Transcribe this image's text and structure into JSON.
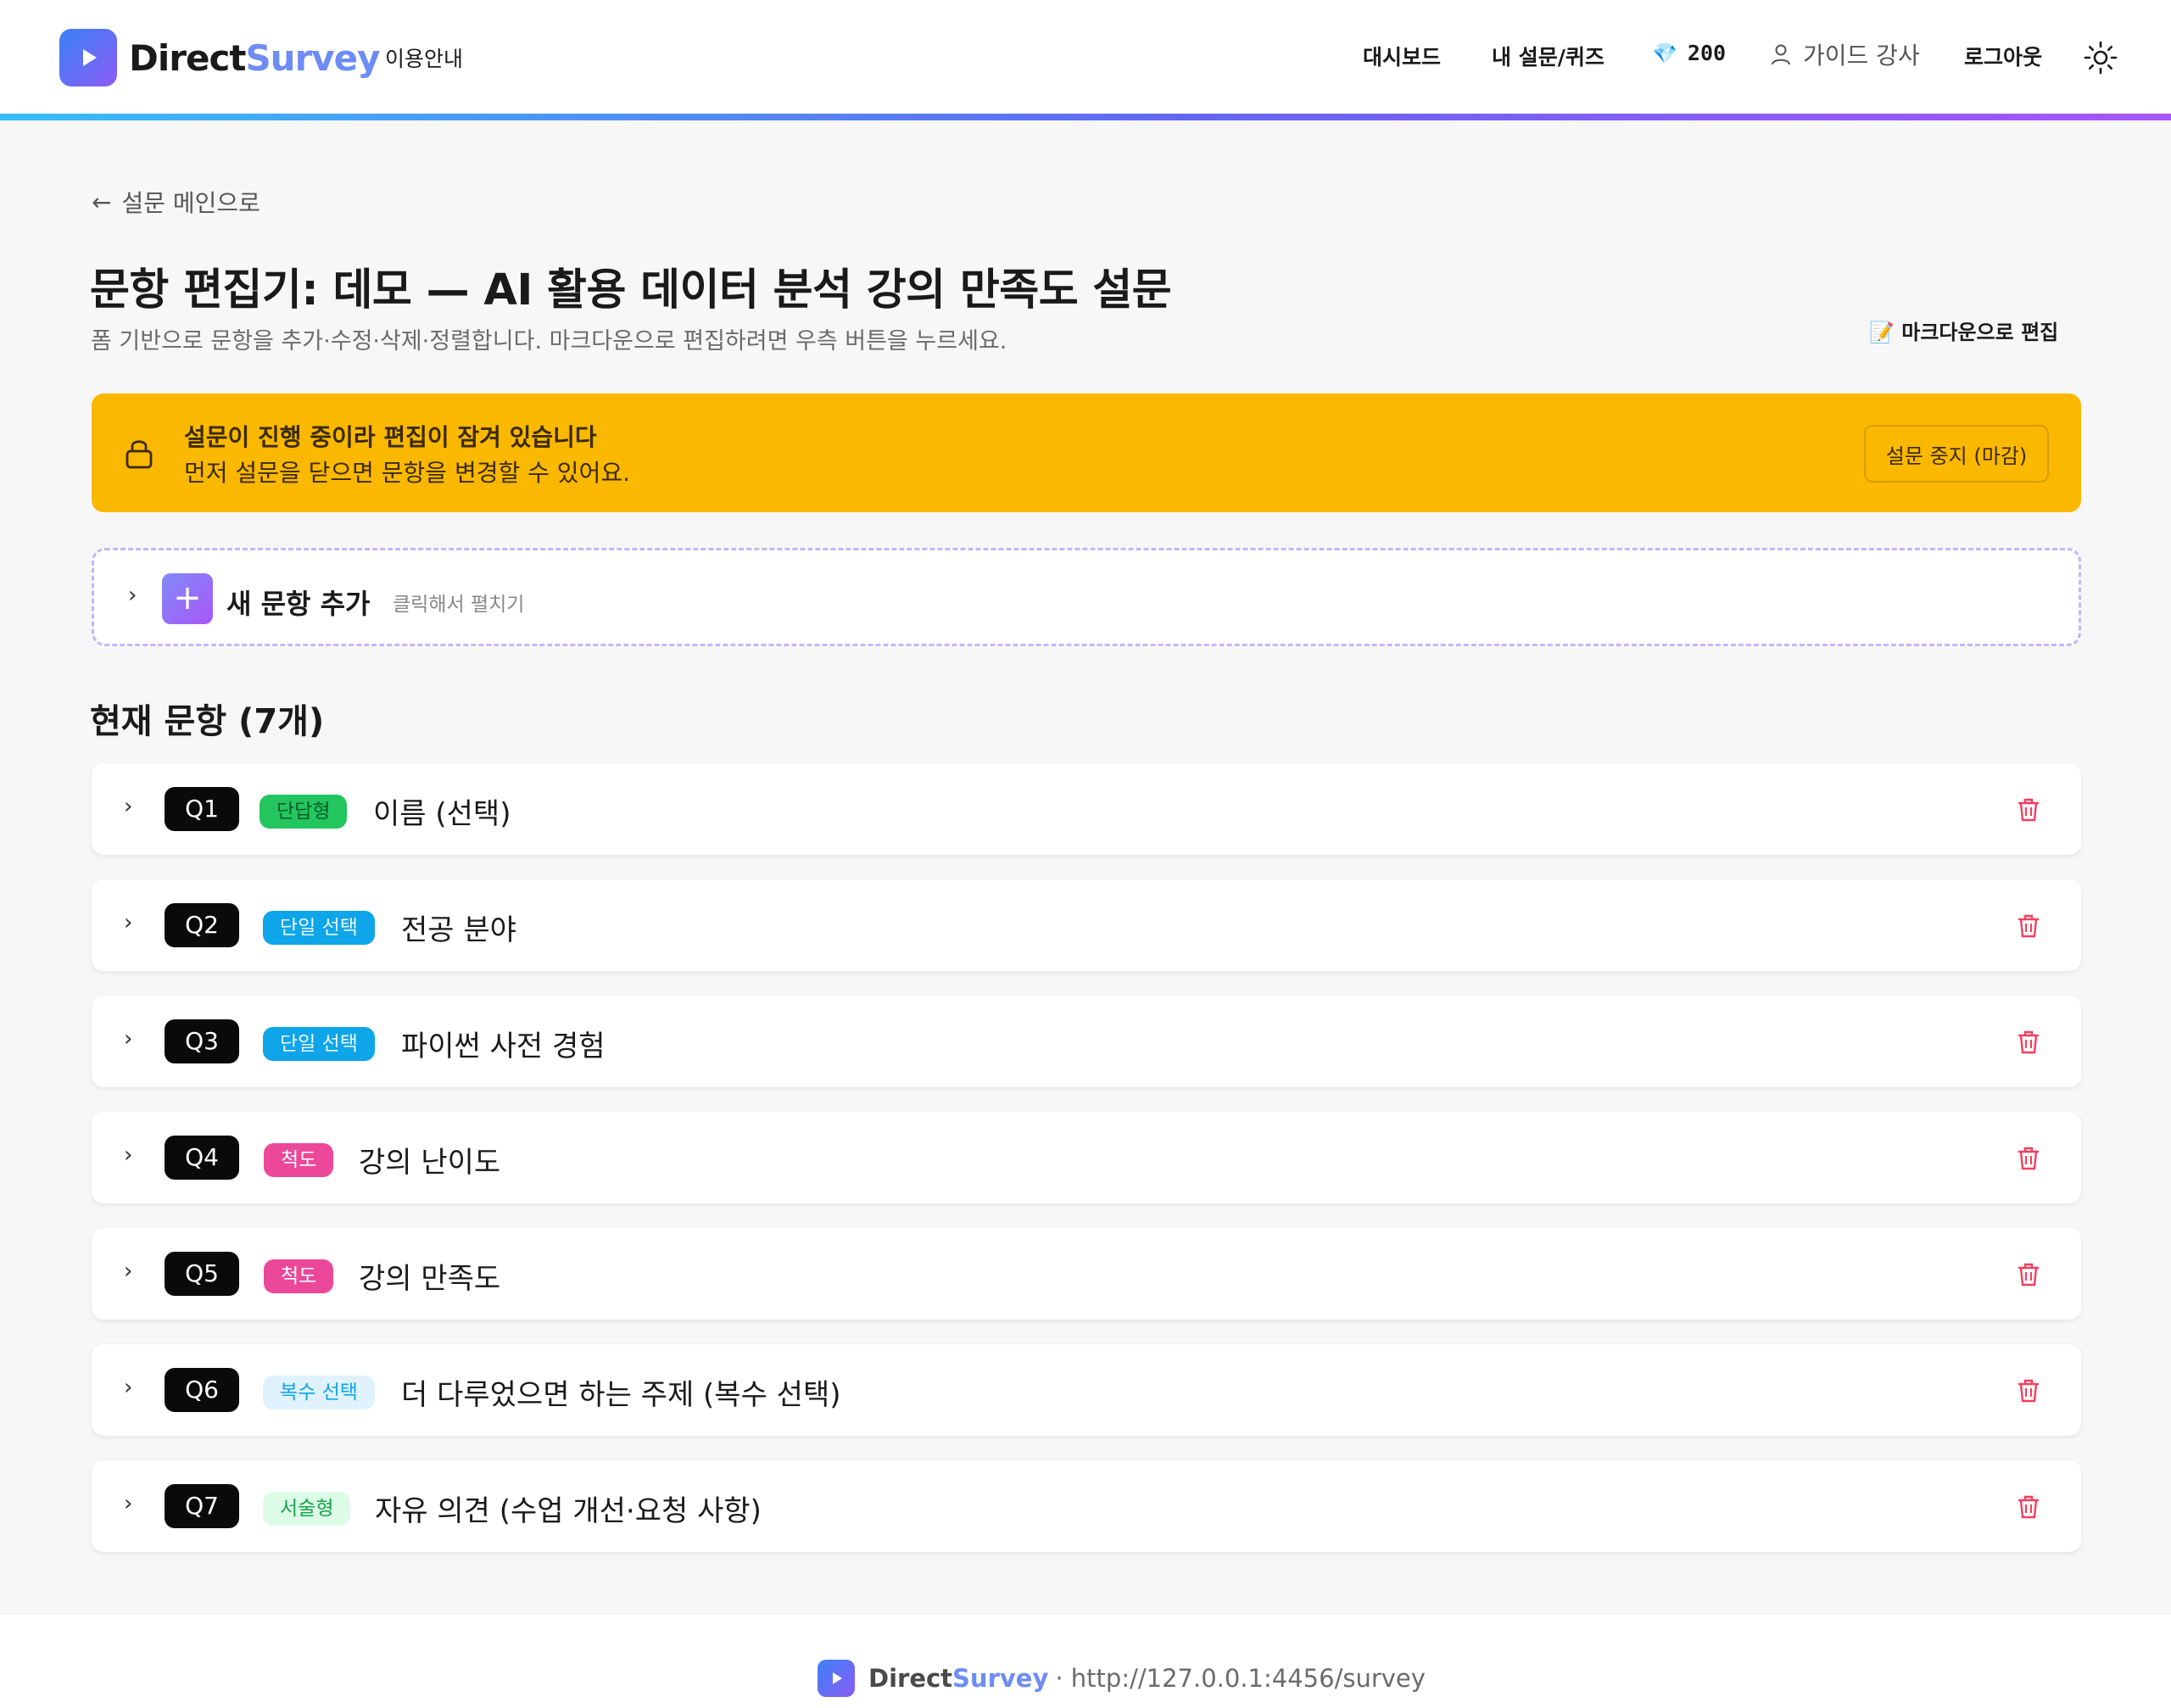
{
  "header": {
    "brand_part1": "Direct",
    "brand_part2": "Survey",
    "nav_guide": "이용안내",
    "nav_dashboard": "대시보드",
    "nav_my_surveys": "내 설문/퀴즈",
    "gem_icon": "💎",
    "credits": "200",
    "user_name": "가이드 강사",
    "logout": "로그아웃"
  },
  "main": {
    "back_label": "설문 메인으로",
    "title": "문항 편집기: 데모 — AI 활용 데이터 분석 강의 만족도 설문",
    "subtitle": "폼 기반으로 문항을 추가·수정·삭제·정렬합니다. 마크다운으로 편집하려면 우측 버튼을 누르세요.",
    "markdown_edit": "📝 마크다운으로 편집"
  },
  "lock_banner": {
    "title": "설문이 진행 중이라 편집이 잠겨 있습니다",
    "description": "먼저 설문을 닫으면 문항을 변경할 수 있어요.",
    "button": "설문 중지 (마감)",
    "color": "#fbb800"
  },
  "add_question": {
    "label": "새 문항 추가",
    "hint": "클릭해서 펼치기"
  },
  "questions_section": {
    "title": "현재 문항 (7개)"
  },
  "questions": [
    {
      "num": "Q1",
      "type": "단답형",
      "text": "이름 (선택)"
    },
    {
      "num": "Q2",
      "type": "단일 선택",
      "text": "전공 분야"
    },
    {
      "num": "Q3",
      "type": "단일 선택",
      "text": "파이썬 사전 경험"
    },
    {
      "num": "Q4",
      "type": "척도",
      "text": "강의 난이도"
    },
    {
      "num": "Q5",
      "type": "척도",
      "text": "강의 만족도"
    },
    {
      "num": "Q6",
      "type": "복수 선택",
      "text": "더 다루었으면 하는 주제 (복수 선택)"
    },
    {
      "num": "Q7",
      "type": "서술형",
      "text": "자유 의견 (수업 개선·요청 사항)"
    }
  ],
  "footer": {
    "brand_part1": "Direct",
    "brand_part2": "Survey",
    "url": "· http://127.0.0.1:4456/survey"
  },
  "colors": {
    "accent_blue": "#6d8cf5",
    "accent_purple": "#8b5cf6",
    "delete_red": "#f43f5e"
  }
}
